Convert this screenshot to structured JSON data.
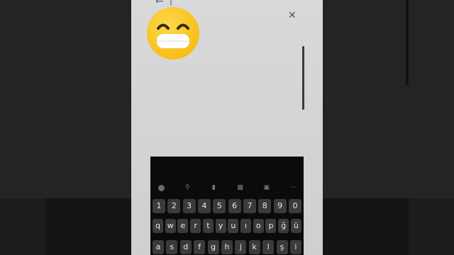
{
  "header": {
    "back_icon": "back-arrow-icon",
    "close_icon": "close-icon"
  },
  "content": {
    "emoji": "grinning-face-emoji"
  },
  "keyboard": {
    "toolbar_icons": [
      "emoji-icon",
      "search-icon",
      "mic-icon",
      "clipboard-icon",
      "keyboard-settings-icon",
      "more-icon"
    ],
    "number_row": [
      "1",
      "2",
      "3",
      "4",
      "5",
      "6",
      "7",
      "8",
      "9",
      "0"
    ],
    "row_q": [
      "q",
      "w",
      "e",
      "r",
      "t",
      "y",
      "u",
      "ı",
      "o",
      "p",
      "ğ",
      "ü"
    ],
    "row_a": [
      "a",
      "s",
      "d",
      "f",
      "g",
      "h",
      "j",
      "k",
      "l",
      "ş",
      "i"
    ]
  },
  "colors": {
    "emoji_yellow": "#f4b400",
    "keyboard_bg": "#0b0b0b",
    "key_bg": "#3b3b3b"
  }
}
